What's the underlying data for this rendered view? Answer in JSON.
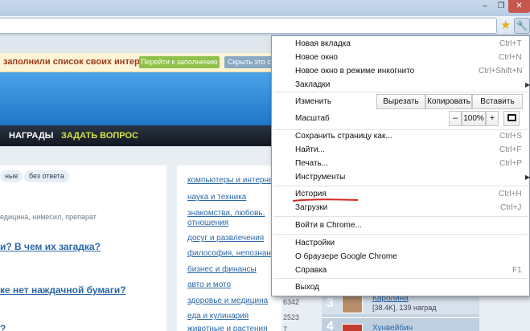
{
  "window": {
    "minimize_glyph": "–",
    "restore_glyph": "❐",
    "close_glyph": "✕"
  },
  "toolbar": {
    "star_icon": "star-icon",
    "wrench_icon": "wrench-icon",
    "star_glyph": "★",
    "wrench_glyph": "🔧"
  },
  "notice": {
    "text": "заполнили список своих интересов",
    "fill_button": "Перейти к заполнению",
    "hide_button": "Скрыть это с"
  },
  "nav": {
    "awards": "НАГРАДЫ",
    "ask": "ЗАДАТЬ ВОПРОС"
  },
  "page": {
    "tags": [
      "ные",
      "без ответа"
    ],
    "crumbs": "едицина, нимесил, препарат",
    "questions": [
      "и? В чем их загадка?",
      "ке нет наждачной бумаги?",
      "?"
    ],
    "categories": [
      {
        "label": "компьютеры и интерне",
        "count": ""
      },
      {
        "label": "наука и техника",
        "count": ""
      },
      {
        "label": "знакомства, любовь,",
        "count": ""
      },
      {
        "label": "отношения",
        "count": ""
      },
      {
        "label": "досуг и развлечения",
        "count": ""
      },
      {
        "label": "философия, непознанн",
        "count": ""
      },
      {
        "label": "бизнес и финансы",
        "count": ""
      },
      {
        "label": "авто и мото",
        "count": ""
      },
      {
        "label": "здоровье и медицина",
        "count": "6342"
      },
      {
        "label": "еда и кулинария",
        "count": "2523"
      },
      {
        "label": "животные и растения",
        "count": "7"
      }
    ],
    "users": [
      {
        "num": "3",
        "name": "Каролина",
        "meta": "[38.4K], 139 наград"
      },
      {
        "num": "4",
        "name": "Хунвейбин",
        "meta": ""
      }
    ]
  },
  "menu": {
    "new_tab": {
      "label": "Новая вкладка",
      "shortcut": "Ctrl+T"
    },
    "new_window": {
      "label": "Новое окно",
      "shortcut": "Ctrl+N"
    },
    "incognito": {
      "label": "Новое окно в режиме инкогнито",
      "shortcut": "Ctrl+Shift+N"
    },
    "bookmarks": {
      "label": "Закладки"
    },
    "edit": {
      "label": "Изменить",
      "cut": "Вырезать",
      "copy": "Копировать",
      "paste": "Вставить"
    },
    "zoom": {
      "label": "Масштаб",
      "minus": "–",
      "value": "100%",
      "plus": "+"
    },
    "save_page": {
      "label": "Сохранить страницу как...",
      "shortcut": "Ctrl+S"
    },
    "find": {
      "label": "Найти...",
      "shortcut": "Ctrl+F"
    },
    "print": {
      "label": "Печать...",
      "shortcut": "Ctrl+P"
    },
    "tools": {
      "label": "Инструменты"
    },
    "history": {
      "label": "История",
      "shortcut": "Ctrl+H"
    },
    "downloads": {
      "label": "Загрузки",
      "shortcut": "Ctrl+J"
    },
    "signin": {
      "label": "Войти в Chrome..."
    },
    "settings": {
      "label": "Настройки"
    },
    "about": {
      "label": "О браузере Google Chrome"
    },
    "help": {
      "label": "Справка",
      "shortcut": "F1"
    },
    "exit": {
      "label": "Выход"
    },
    "submenu_arrow": "▶"
  },
  "colors": {
    "annotation_underline": "#d22a2a",
    "banner_blue": "#1f77c9",
    "nav_dark": "#121821"
  }
}
